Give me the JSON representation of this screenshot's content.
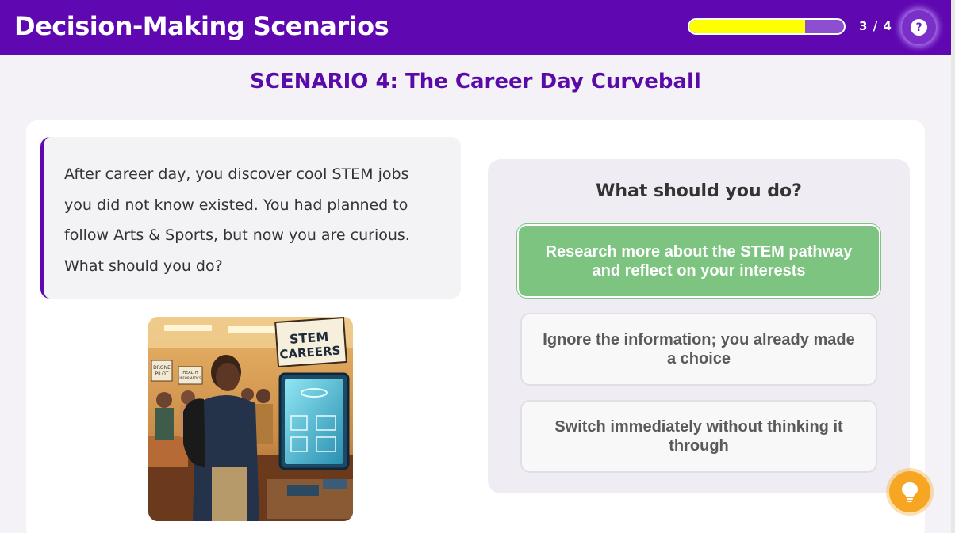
{
  "header": {
    "title": "Decision-Making Scenarios",
    "progress_fraction": 0.75,
    "progress_text": "3 / 4",
    "help_glyph": "?"
  },
  "scenario": {
    "heading": "SCENARIO 4: The Career Day Curveball",
    "prompt": "After career day, you discover cool STEM jobs you did not know existed. You had planned to follow Arts & Sports, but now you are curious. What should you do?",
    "image": {
      "sign_line1": "STEM",
      "sign_line2": "CAREERS",
      "booth1_line1": "DRONE",
      "booth1_line2": "PILOT",
      "booth2_line1": "HEALTH",
      "booth2_line2": "INFORMATICS"
    }
  },
  "question": {
    "title": "What should you do?",
    "options": [
      {
        "label": "Research more about the STEM pathway and reflect on your interests",
        "state": "selected"
      },
      {
        "label": "Ignore the information; you already made a choice",
        "state": "default"
      },
      {
        "label": "Switch immediately without thinking it through",
        "state": "default"
      }
    ]
  },
  "colors": {
    "brand": "#5f08b2",
    "progress": "#ffff00",
    "selected_option": "#7cc47f",
    "hint": "#f6a623"
  },
  "icons": {
    "help": "question-mark-icon",
    "hint": "lightbulb-icon"
  }
}
